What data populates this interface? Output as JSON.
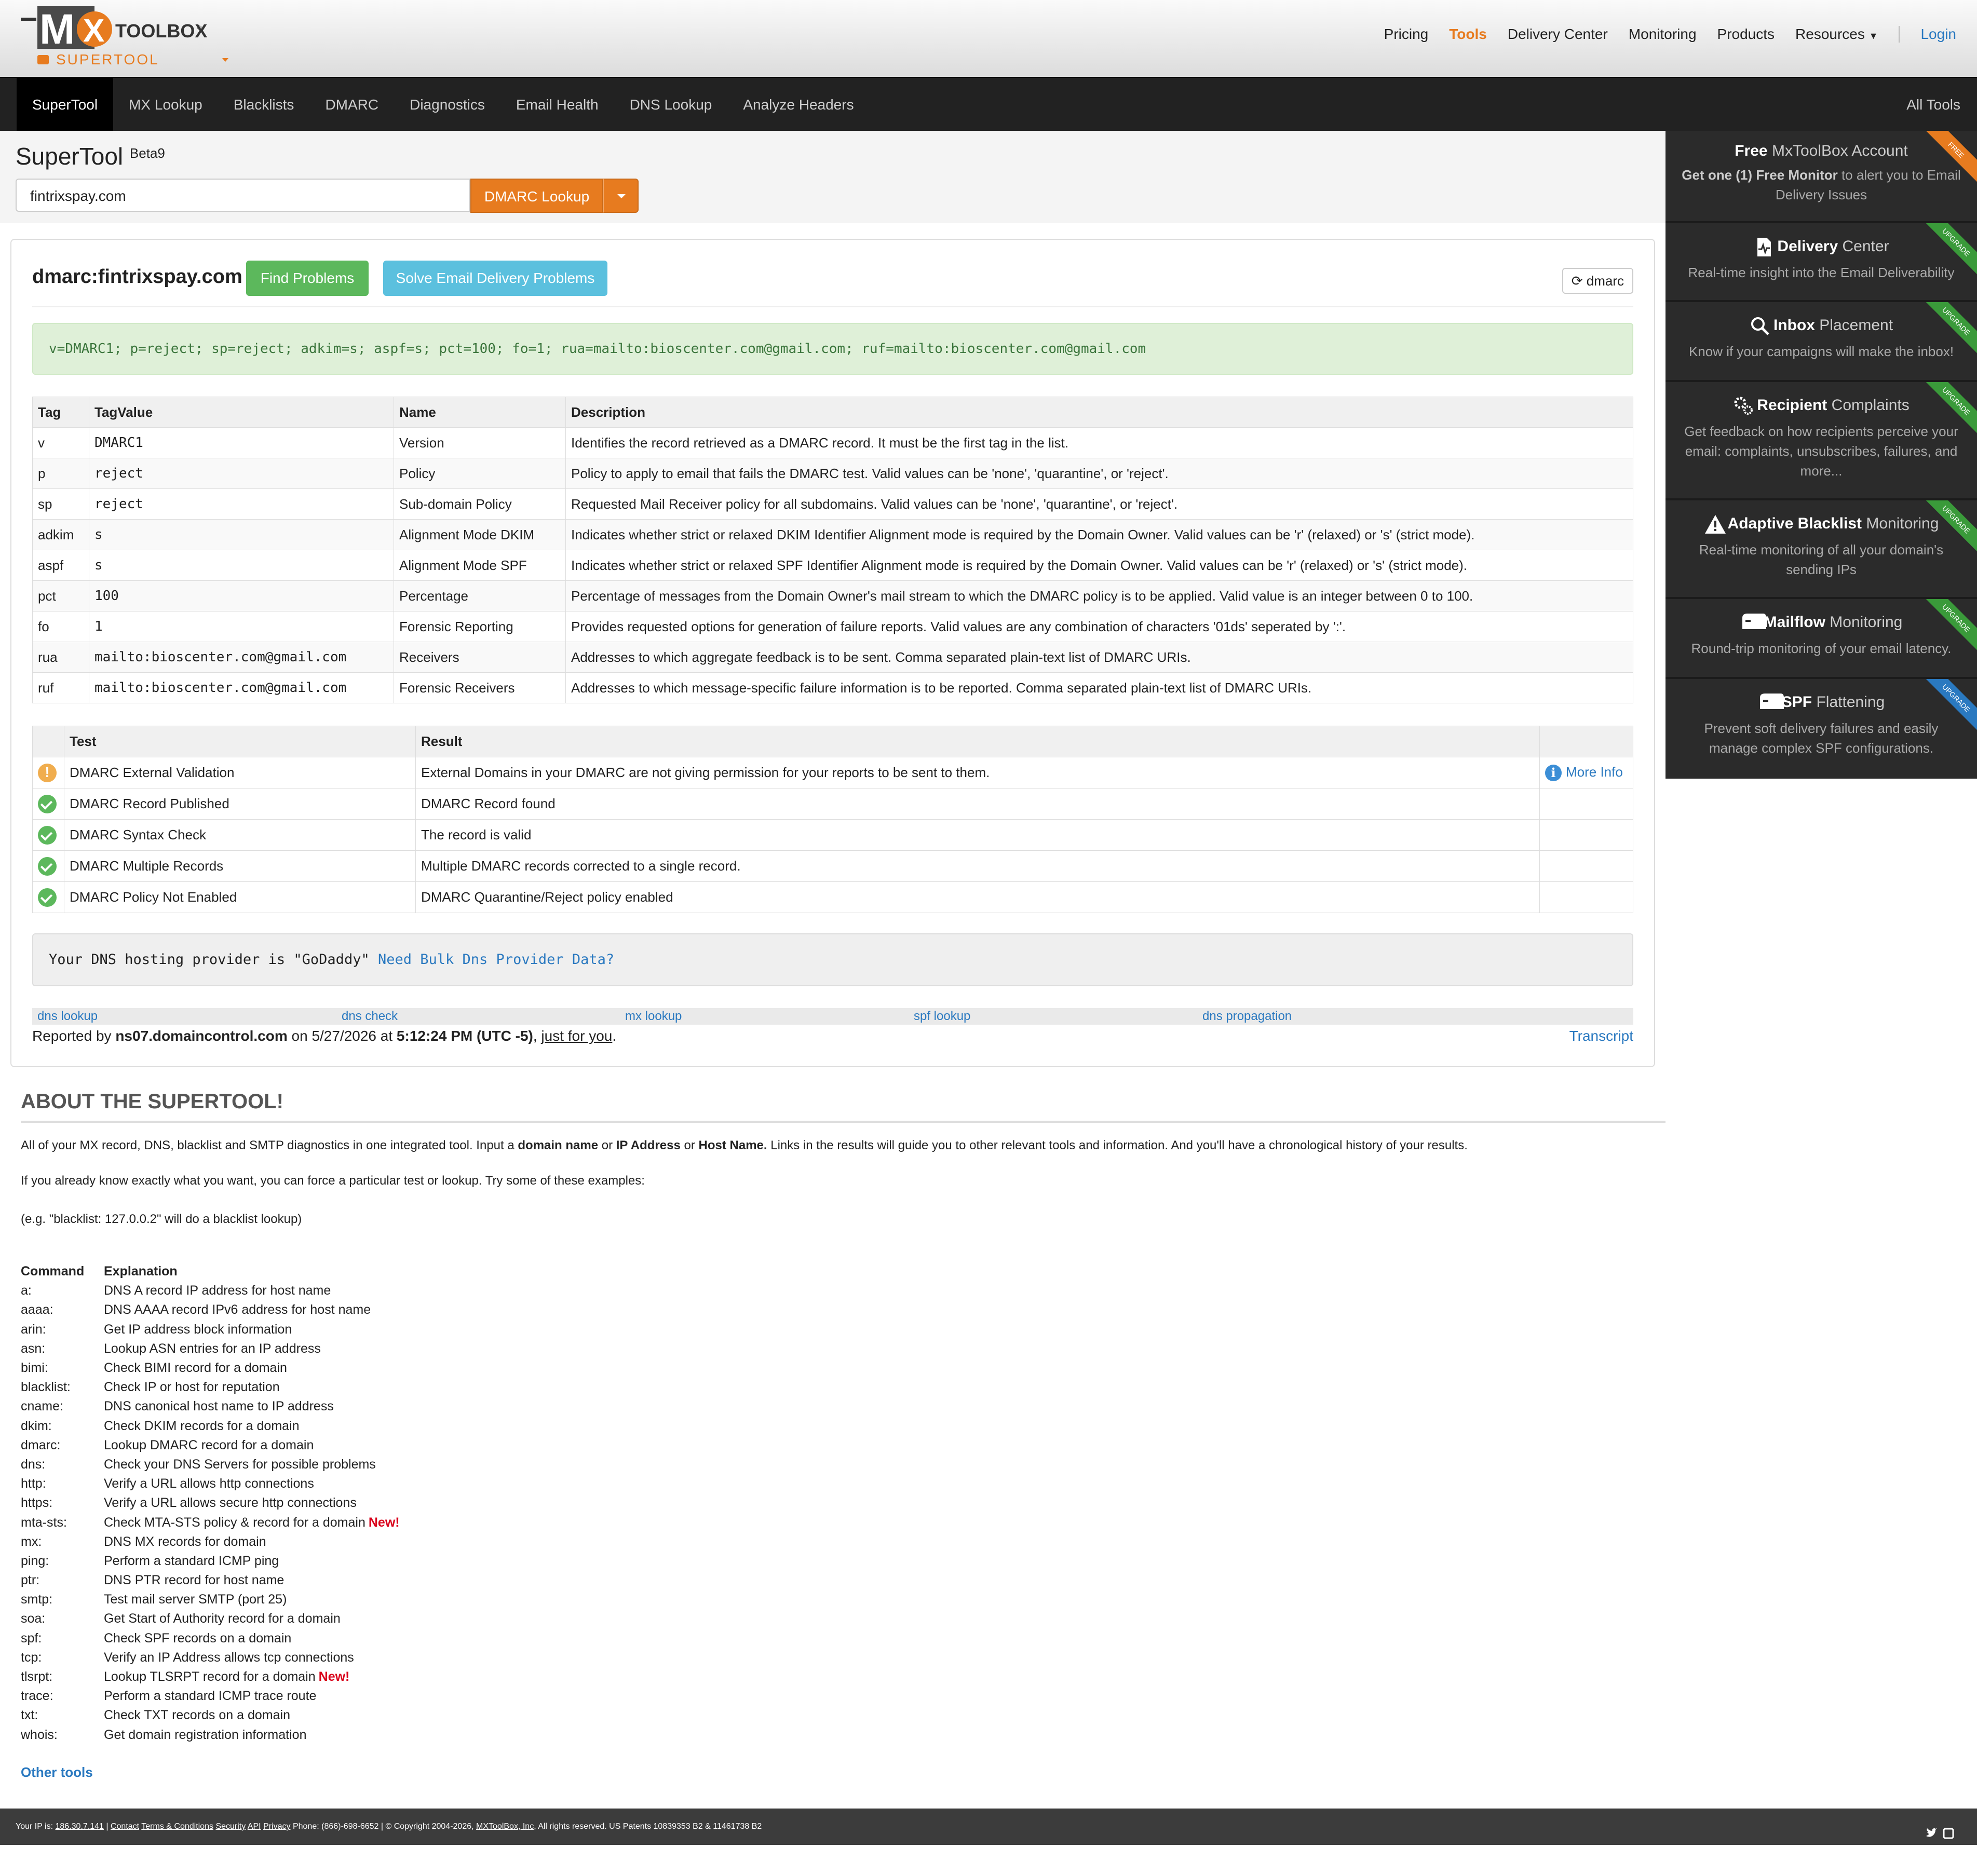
{
  "header": {
    "logo_text": "MXTOOLBOX",
    "logo_sub": "SUPERTOOL",
    "nav": [
      "Pricing",
      "Tools",
      "Delivery Center",
      "Monitoring",
      "Products",
      "Resources"
    ],
    "login": "Login"
  },
  "navbar": {
    "items": [
      "SuperTool",
      "MX Lookup",
      "Blacklists",
      "DMARC",
      "Diagnostics",
      "Email Health",
      "DNS Lookup",
      "Analyze Headers"
    ],
    "all_tools": "All Tools"
  },
  "search": {
    "title": "SuperTool",
    "beta": "Beta9",
    "value": "fintrixspay.com",
    "button": "DMARC Lookup"
  },
  "result": {
    "title": "dmarc:fintrixspay.com",
    "find_problems": "Find Problems",
    "solve": "Solve Email Delivery Problems",
    "refresh": "dmarc",
    "record": "v=DMARC1; p=reject; sp=reject; adkim=s; aspf=s; pct=100; fo=1; rua=mailto:bioscenter.com@gmail.com; ruf=mailto:bioscenter.com@gmail.com",
    "tag_headers": [
      "Tag",
      "TagValue",
      "Name",
      "Description"
    ],
    "tags": [
      [
        "v",
        "DMARC1",
        "Version",
        "Identifies the record retrieved as a DMARC record. It must be the first tag in the list."
      ],
      [
        "p",
        "reject",
        "Policy",
        "Policy to apply to email that fails the DMARC test. Valid values can be 'none', 'quarantine', or 'reject'."
      ],
      [
        "sp",
        "reject",
        "Sub-domain Policy",
        "Requested Mail Receiver policy for all subdomains. Valid values can be 'none', 'quarantine', or 'reject'."
      ],
      [
        "adkim",
        "s",
        "Alignment Mode DKIM",
        "Indicates whether strict or relaxed DKIM Identifier Alignment mode is required by the Domain Owner. Valid values can be 'r' (relaxed) or 's' (strict mode)."
      ],
      [
        "aspf",
        "s",
        "Alignment Mode SPF",
        "Indicates whether strict or relaxed SPF Identifier Alignment mode is required by the Domain Owner. Valid values can be 'r' (relaxed) or 's' (strict mode)."
      ],
      [
        "pct",
        "100",
        "Percentage",
        "Percentage of messages from the Domain Owner's mail stream to which the DMARC policy is to be applied. Valid value is an integer between 0 to 100."
      ],
      [
        "fo",
        "1",
        "Forensic Reporting",
        "Provides requested options for generation of failure reports. Valid values are any combination of characters '01ds' seperated by ':'."
      ],
      [
        "rua",
        "mailto:bioscenter.com@gmail.com",
        "Receivers",
        "Addresses to which aggregate feedback is to be sent. Comma separated plain-text list of DMARC URIs."
      ],
      [
        "ruf",
        "mailto:bioscenter.com@gmail.com",
        "Forensic Receivers",
        "Addresses to which message-specific failure information is to be reported. Comma separated plain-text list of DMARC URIs."
      ]
    ],
    "test_headers": [
      "",
      "Test",
      "Result",
      ""
    ],
    "tests": [
      {
        "status": "warning",
        "test": "DMARC External Validation",
        "result": "External Domains in your DMARC are not giving permission for your reports to be sent to them.",
        "more": "More Info"
      },
      {
        "status": "ok",
        "test": "DMARC Record Published",
        "result": "DMARC Record found",
        "more": ""
      },
      {
        "status": "ok",
        "test": "DMARC Syntax Check",
        "result": "The record is valid",
        "more": ""
      },
      {
        "status": "ok",
        "test": "DMARC Multiple Records",
        "result": "Multiple DMARC records corrected to a single record.",
        "more": ""
      },
      {
        "status": "ok",
        "test": "DMARC Policy Not Enabled",
        "result": "DMARC Quarantine/Reject policy enabled",
        "more": ""
      }
    ],
    "dns_text": "Your DNS hosting provider is \"GoDaddy\"",
    "dns_link": "Need Bulk Dns Provider Data?",
    "links": [
      "dns lookup",
      "dns check",
      "mx lookup",
      "spf lookup",
      "dns propagation"
    ],
    "reported_by_prefix": "Reported by",
    "reported_server": "ns07.domaincontrol.com",
    "reported_on": "on 5/27/2026 at",
    "reported_time": "5:12:24 PM (UTC -5)",
    "just_for_you": "just for you",
    "transcript": "Transcript"
  },
  "sidebar": [
    {
      "bold": "Free",
      "light": "MxToolBox Account",
      "desc_bold": "Get one (1) Free Monitor",
      "desc": "to alert you to Email Delivery Issues",
      "ribbon": "FREE",
      "ribbon_color": "#e77b1f"
    },
    {
      "bold": "Delivery",
      "light": "Center",
      "desc": "Real-time insight into the Email Deliverability",
      "ribbon": "UPGRADE",
      "ribbon_color": "#3a9a3a"
    },
    {
      "bold": "Inbox",
      "light": "Placement",
      "desc": "Know if your campaigns will make the inbox!",
      "ribbon": "UPGRADE",
      "ribbon_color": "#3a9a3a"
    },
    {
      "bold": "Recipient",
      "light": "Complaints",
      "desc": "Get feedback on how recipients perceive your email: complaints, unsubscribes, failures, and more...",
      "ribbon": "UPGRADE",
      "ribbon_color": "#3a9a3a"
    },
    {
      "bold": "Adaptive Blacklist",
      "light": "Monitoring",
      "desc": "Real-time monitoring of all your domain's sending IPs",
      "ribbon": "UPGRADE",
      "ribbon_color": "#3a9a3a"
    },
    {
      "bold": "Mailflow",
      "light": "Monitoring",
      "desc": "Round-trip monitoring of your email latency.",
      "ribbon": "UPGRADE",
      "ribbon_color": "#3a9a3a"
    },
    {
      "bold": "SPF",
      "light": "Flattening",
      "desc": "Prevent soft delivery failures and easily manage complex SPF configurations.",
      "ribbon": "UPGRADE",
      "ribbon_color": "#2a79c0"
    }
  ],
  "about": {
    "title": "ABOUT THE SUPERTOOL!",
    "p1_a": "All of your MX record, DNS, blacklist and SMTP diagnostics in one integrated tool.  Input a",
    "p1_b": "domain name",
    "p1_c": "or",
    "p1_d": "IP Address",
    "p1_e": "or",
    "p1_f": "Host Name.",
    "p1_g": "Links in the results will guide you to other relevant tools and information.  And you'll have a chronological history of your results.",
    "p2": "If you already know exactly what you want, you can force a particular test or lookup.  Try some of these examples:",
    "p3": "(e.g. \"blacklist: 127.0.0.2\" will do a blacklist lookup)",
    "cmd_header": "Command",
    "exp_header": "Explanation",
    "new_label": "New!",
    "commands": [
      [
        "a:",
        "DNS A record IP address for host name",
        false
      ],
      [
        "aaaa:",
        "DNS AAAA record IPv6 address for host name",
        false
      ],
      [
        "arin:",
        "Get IP address block information",
        false
      ],
      [
        "asn:",
        "Lookup ASN entries for an IP address",
        false
      ],
      [
        "bimi:",
        "Check BIMI record for a domain",
        false
      ],
      [
        "blacklist:",
        "Check IP or host for reputation",
        false
      ],
      [
        "cname:",
        "DNS canonical host name to IP address",
        false
      ],
      [
        "dkim:",
        "Check DKIM records for a domain",
        false
      ],
      [
        "dmarc:",
        "Lookup DMARC record for a domain",
        false
      ],
      [
        "dns:",
        "Check your DNS Servers for possible problems",
        false
      ],
      [
        "http:",
        "Verify a URL allows http connections",
        false
      ],
      [
        "https:",
        "Verify a URL allows secure http connections",
        false
      ],
      [
        "mta-sts:",
        "Check MTA-STS policy & record for a domain",
        true
      ],
      [
        "mx:",
        "DNS MX records for domain",
        false
      ],
      [
        "ping:",
        "Perform a standard ICMP ping",
        false
      ],
      [
        "ptr:",
        "DNS PTR record for host name",
        false
      ],
      [
        "smtp:",
        "Test mail server SMTP (port 25)",
        false
      ],
      [
        "soa:",
        "Get Start of Authority record for a domain",
        false
      ],
      [
        "spf:",
        "Check SPF records on a domain",
        false
      ],
      [
        "tcp:",
        "Verify an IP Address allows tcp connections",
        false
      ],
      [
        "tlsrpt:",
        "Lookup TLSRPT record for a domain",
        true
      ],
      [
        "trace:",
        "Perform a standard ICMP trace route",
        false
      ],
      [
        "txt:",
        "Check TXT records on a domain",
        false
      ],
      [
        "whois:",
        "Get domain registration information",
        false
      ]
    ],
    "other_tools": "Other tools"
  },
  "footer": {
    "ip_label": "Your IP is:",
    "ip": "186.30.7.141",
    "links": [
      "Contact",
      "Terms & Conditions",
      "Security",
      "API",
      "Privacy"
    ],
    "phone": "Phone: (866)-698-6652",
    "copyright": "© Copyright 2004-2026,",
    "company": "MXToolBox, Inc",
    "rights": ", All rights reserved. US Patents 10839353 B2 & 11461738 B2"
  },
  "colors": {
    "accent": "#e77b1f",
    "link": "#2a79c0",
    "green": "#5cb85c",
    "cyan": "#5bc0de",
    "nav_bg": "#222222"
  }
}
